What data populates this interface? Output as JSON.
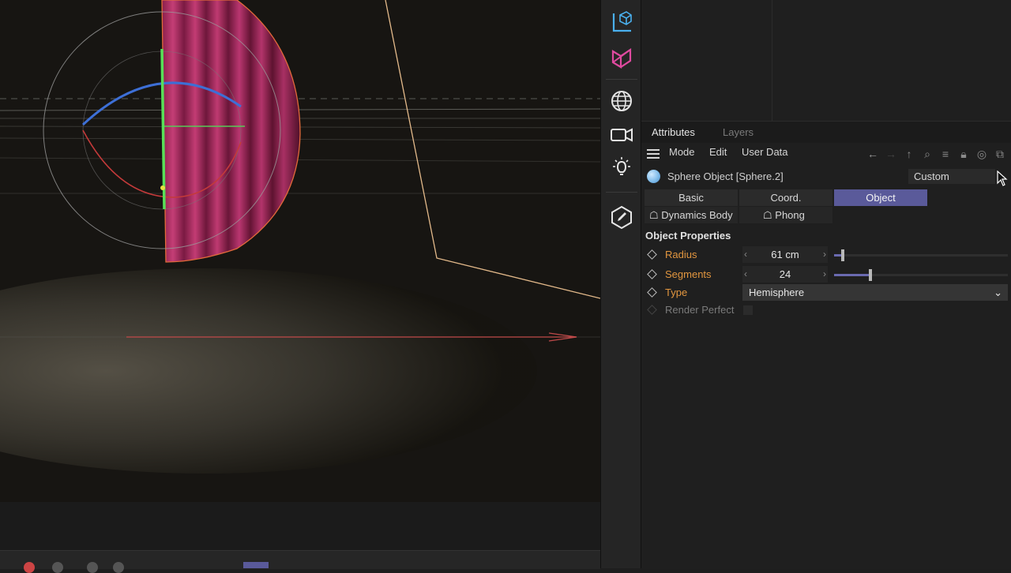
{
  "viewport": {
    "title": ""
  },
  "toolbar": {
    "icons": [
      "cube-axis-icon",
      "deformer-icon",
      "globe-icon",
      "camera-icon",
      "light-icon",
      "edit-tag-icon"
    ]
  },
  "attributes": {
    "tabs": [
      {
        "label": "Attributes",
        "active": true
      },
      {
        "label": "Layers",
        "active": false
      }
    ],
    "menu": {
      "mode": "Mode",
      "edit": "Edit",
      "user_data": "User Data"
    },
    "object": {
      "title": "Sphere Object [Sphere.2]",
      "mode_select": "Custom"
    },
    "prop_tabs": {
      "basic": "Basic",
      "coord": "Coord.",
      "object": "Object",
      "dynamics": "Dynamics Body",
      "phong": "Phong"
    },
    "section_title": "Object Properties",
    "properties": {
      "radius": {
        "label": "Radius",
        "value": "61 cm",
        "slider_fraction": 0.05
      },
      "segments": {
        "label": "Segments",
        "value": "24",
        "slider_fraction": 0.21
      },
      "type": {
        "label": "Type",
        "value": "Hemisphere"
      },
      "render_perfect": {
        "label": "Render Perfect",
        "checked": false
      }
    },
    "colors": {
      "accent": "#5a5a9a",
      "label_orange": "#e2963f"
    }
  }
}
